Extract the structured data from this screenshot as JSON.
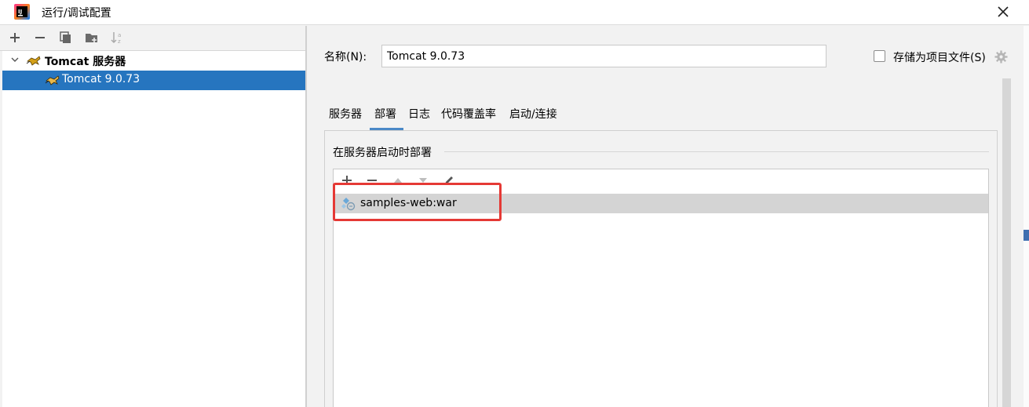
{
  "window": {
    "title": "运行/调试配置",
    "app_icon": "intellij-idea-icon",
    "close_icon": "close-icon"
  },
  "left_toolbar": {
    "icons": [
      "add-icon",
      "remove-icon",
      "copy-icon",
      "new-folder-icon",
      "sort-icon"
    ]
  },
  "tree": {
    "root": {
      "label": "Tomcat 服务器",
      "icon": "tomcat-icon",
      "expanded": true
    },
    "children": [
      {
        "label": "Tomcat 9.0.73",
        "icon": "tomcat-icon",
        "selected": true
      }
    ]
  },
  "config": {
    "name_label": "名称(N):",
    "name_value": "Tomcat 9.0.73",
    "store_label": "存储为项目文件(S)",
    "store_checked": false
  },
  "tabs": [
    {
      "label": "服务器",
      "active": false
    },
    {
      "label": "部署",
      "active": true
    },
    {
      "label": "日志",
      "active": false
    },
    {
      "label": "代码覆盖率",
      "active": false
    },
    {
      "label": "启动/连接",
      "active": false
    }
  ],
  "deploy": {
    "section_title": "在服务器启动时部署",
    "toolbar_icons": [
      "add-icon",
      "remove-icon",
      "move-up-icon",
      "move-down-icon",
      "edit-icon"
    ],
    "items": [
      {
        "label": "samples-web:war",
        "icon": "artifact-icon",
        "selected": true
      }
    ]
  },
  "colors": {
    "selection": "#2675bf",
    "tab_underline": "#4a88c7",
    "highlight": "#e53935"
  }
}
